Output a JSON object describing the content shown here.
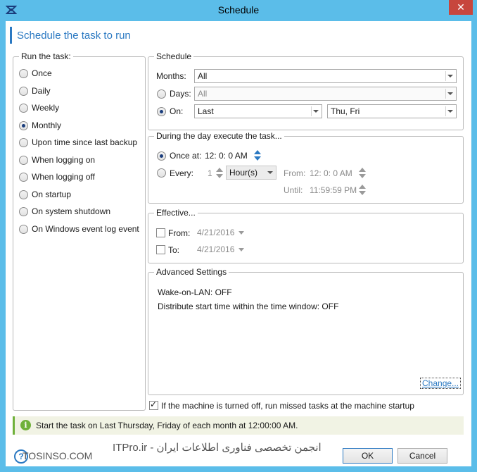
{
  "window": {
    "title": "Schedule"
  },
  "header": {
    "title": "Schedule the task to run"
  },
  "run_task": {
    "legend": "Run the task:",
    "options": [
      {
        "label": "Once",
        "checked": false
      },
      {
        "label": "Daily",
        "checked": false
      },
      {
        "label": "Weekly",
        "checked": false
      },
      {
        "label": "Monthly",
        "checked": true
      },
      {
        "label": "Upon time since last backup",
        "checked": false
      },
      {
        "label": "When logging on",
        "checked": false
      },
      {
        "label": "When logging off",
        "checked": false
      },
      {
        "label": "On startup",
        "checked": false
      },
      {
        "label": "On system shutdown",
        "checked": false
      },
      {
        "label": "On Windows event log event",
        "checked": false
      }
    ]
  },
  "schedule": {
    "legend": "Schedule",
    "months_label": "Months:",
    "months_value": "All",
    "days_label": "Days:",
    "days_value": "All",
    "on_label": "On:",
    "on_which": "Last",
    "on_days": "Thu, Fri"
  },
  "during_day": {
    "legend": "During the day execute the task...",
    "once_at_label": "Once at:",
    "once_at_value": "12:  0:  0 AM",
    "every_label": "Every:",
    "every_value": "1",
    "every_unit": "Hour(s)",
    "from_label": "From:",
    "from_value": "12:  0:  0 AM",
    "until_label": "Until:",
    "until_value": "11:59:59 PM"
  },
  "effective": {
    "legend": "Effective...",
    "from_label": "From:",
    "from_value": "4/21/2016",
    "to_label": "To:",
    "to_value": "4/21/2016"
  },
  "advanced": {
    "legend": "Advanced Settings",
    "line1": "Wake-on-LAN: OFF",
    "line2": "Distribute start time within the time window: OFF",
    "change_label": "Change..."
  },
  "missed_tasks": {
    "label": "If the machine is turned off, run missed tasks at the machine startup",
    "checked": true
  },
  "status": {
    "text": "Start the task on Last Thursday, Friday of each month at 12:00:00 AM."
  },
  "buttons": {
    "ok": "OK",
    "cancel": "Cancel"
  },
  "watermark": {
    "left": "TOSINSO.COM",
    "right": "ITPro.ir - انجمن تخصصی فناوری اطلاعات ایران"
  }
}
